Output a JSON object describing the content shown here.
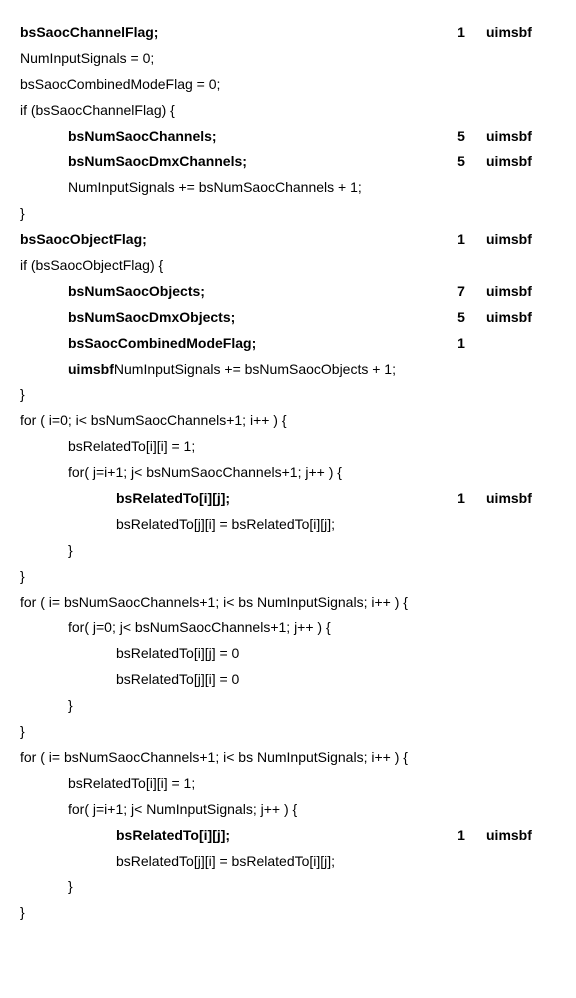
{
  "rows": [
    {
      "indent": 0,
      "segments": [
        {
          "t": "bsSaocChannelFlag;",
          "b": true
        }
      ],
      "bits": "1",
      "mnem": "uimsbf"
    },
    {
      "indent": 0,
      "segments": [
        {
          "t": "NumInputSignals = 0;",
          "b": false
        }
      ],
      "bits": "",
      "mnem": ""
    },
    {
      "indent": 0,
      "segments": [
        {
          "t": "bsSaocCombinedModeFlag = 0;",
          "b": false
        }
      ],
      "bits": "",
      "mnem": ""
    },
    {
      "indent": 0,
      "segments": [
        {
          "t": "if (bsSaocChannelFlag) {",
          "b": false
        }
      ],
      "bits": "",
      "mnem": ""
    },
    {
      "indent": 1,
      "segments": [
        {
          "t": "bsNumSaocChannels;",
          "b": true
        }
      ],
      "bits": "5",
      "mnem": "uimsbf"
    },
    {
      "indent": 1,
      "segments": [
        {
          "t": "bsNumSaocDmxChannels;",
          "b": true
        }
      ],
      "bits": "5",
      "mnem": "uimsbf"
    },
    {
      "indent": 1,
      "segments": [
        {
          "t": "NumInputSignals += bsNumSaocChannels + 1;",
          "b": false
        }
      ],
      "bits": "",
      "mnem": ""
    },
    {
      "indent": 0,
      "segments": [
        {
          "t": "}",
          "b": false
        }
      ],
      "bits": "",
      "mnem": ""
    },
    {
      "indent": 0,
      "segments": [
        {
          "t": "bsSaocObjectFlag;",
          "b": true
        }
      ],
      "bits": "1",
      "mnem": "uimsbf"
    },
    {
      "indent": 0,
      "segments": [
        {
          "t": "if (bsSaocObjectFlag) {",
          "b": false
        }
      ],
      "bits": "",
      "mnem": ""
    },
    {
      "indent": 1,
      "segments": [
        {
          "t": "bsNumSaocObjects;",
          "b": true
        }
      ],
      "bits": "7",
      "mnem": "uimsbf"
    },
    {
      "indent": 1,
      "segments": [
        {
          "t": "bsNumSaocDmxObjects;",
          "b": true
        }
      ],
      "bits": "5",
      "mnem": "uimsbf"
    },
    {
      "indent": 1,
      "segments": [
        {
          "t": "bsSaocCombinedModeFlag;",
          "b": true
        }
      ],
      "bits": "1",
      "mnem": ""
    },
    {
      "indent": 1,
      "segments": [
        {
          "t": "uimsbf",
          "b": true
        },
        {
          "t": "NumInputSignals += bsNumSaocObjects + 1;",
          "b": false
        }
      ],
      "bits": "",
      "mnem": ""
    },
    {
      "indent": 0,
      "segments": [
        {
          "t": "}",
          "b": false
        }
      ],
      "bits": "",
      "mnem": ""
    },
    {
      "indent": 0,
      "segments": [
        {
          "t": "for ( i=0; i< bsNumSaocChannels+1; i++ ) {",
          "b": false
        }
      ],
      "bits": "",
      "mnem": ""
    },
    {
      "indent": 1,
      "segments": [
        {
          "t": "bsRelatedTo[i][i] = 1;",
          "b": false
        }
      ],
      "bits": "",
      "mnem": ""
    },
    {
      "indent": 1,
      "segments": [
        {
          "t": "for( j=i+1; j< bsNumSaocChannels+1; j++ ) {",
          "b": false
        }
      ],
      "bits": "",
      "mnem": ""
    },
    {
      "indent": 2,
      "segments": [
        {
          "t": "bsRelatedTo[i][j];",
          "b": true
        }
      ],
      "bits": "1",
      "mnem": "uimsbf"
    },
    {
      "indent": 2,
      "segments": [
        {
          "t": "bsRelatedTo[j][i] = bsRelatedTo[i][j];",
          "b": false
        }
      ],
      "bits": "",
      "mnem": ""
    },
    {
      "indent": 1,
      "segments": [
        {
          "t": "}",
          "b": false
        }
      ],
      "bits": "",
      "mnem": ""
    },
    {
      "indent": 0,
      "segments": [
        {
          "t": "}",
          "b": false
        }
      ],
      "bits": "",
      "mnem": ""
    },
    {
      "indent": 0,
      "segments": [
        {
          "t": "for ( i= bsNumSaocChannels+1; i< bs NumInputSignals; i++ ) {",
          "b": false
        }
      ],
      "bits": "",
      "mnem": ""
    },
    {
      "indent": 1,
      "segments": [
        {
          "t": "for( j=0; j< bsNumSaocChannels+1; j++ ) {",
          "b": false
        }
      ],
      "bits": "",
      "mnem": ""
    },
    {
      "indent": 2,
      "segments": [
        {
          "t": "bsRelatedTo[i][j] = 0",
          "b": false
        }
      ],
      "bits": "",
      "mnem": ""
    },
    {
      "indent": 2,
      "segments": [
        {
          "t": "bsRelatedTo[j][i] = 0",
          "b": false
        }
      ],
      "bits": "",
      "mnem": ""
    },
    {
      "indent": 1,
      "segments": [
        {
          "t": "}",
          "b": false
        }
      ],
      "bits": "",
      "mnem": ""
    },
    {
      "indent": 0,
      "segments": [
        {
          "t": "}",
          "b": false
        }
      ],
      "bits": "",
      "mnem": ""
    },
    {
      "indent": 0,
      "segments": [
        {
          "t": "for ( i= bsNumSaocChannels+1; i< bs NumInputSignals; i++ ) {",
          "b": false
        }
      ],
      "bits": "",
      "mnem": ""
    },
    {
      "indent": 1,
      "segments": [
        {
          "t": "bsRelatedTo[i][i] = 1;",
          "b": false
        }
      ],
      "bits": "",
      "mnem": ""
    },
    {
      "indent": 1,
      "segments": [
        {
          "t": "for( j=i+1; j< NumInputSignals; j++ ) {",
          "b": false
        }
      ],
      "bits": "",
      "mnem": ""
    },
    {
      "indent": 2,
      "segments": [
        {
          "t": "bsRelatedTo[i][j];",
          "b": true
        }
      ],
      "bits": "1",
      "mnem": "uimsbf"
    },
    {
      "indent": 2,
      "segments": [
        {
          "t": "bsRelatedTo[j][i] = bsRelatedTo[i][j];",
          "b": false
        }
      ],
      "bits": "",
      "mnem": ""
    },
    {
      "indent": 1,
      "segments": [
        {
          "t": "}",
          "b": false
        }
      ],
      "bits": "",
      "mnem": ""
    },
    {
      "indent": 0,
      "segments": [
        {
          "t": "}",
          "b": false
        }
      ],
      "bits": "",
      "mnem": ""
    }
  ]
}
